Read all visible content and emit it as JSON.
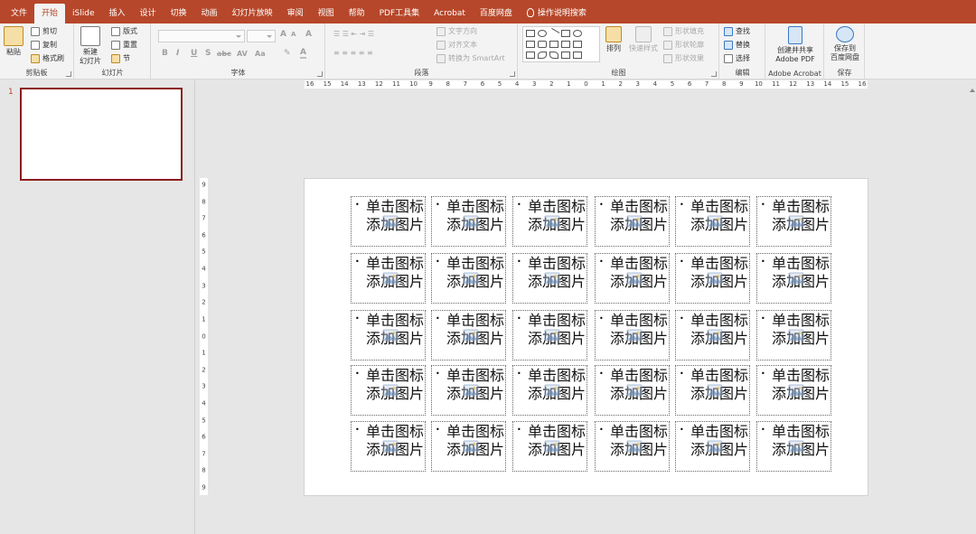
{
  "menu": {
    "tabs": [
      {
        "label": "文件"
      },
      {
        "label": "开始",
        "active": true
      },
      {
        "label": "iSlide"
      },
      {
        "label": "插入"
      },
      {
        "label": "设计"
      },
      {
        "label": "切换"
      },
      {
        "label": "动画"
      },
      {
        "label": "幻灯片放映"
      },
      {
        "label": "审阅"
      },
      {
        "label": "视图"
      },
      {
        "label": "帮助"
      },
      {
        "label": "PDF工具集"
      },
      {
        "label": "Acrobat"
      },
      {
        "label": "百度网盘"
      }
    ],
    "tell_me": "操作说明搜索",
    "accent_color": "#b7472a"
  },
  "ribbon": {
    "clipboard": {
      "paste": "粘贴",
      "cut": "剪切",
      "copy": "复制",
      "format_painter": "格式刷",
      "label": "剪贴板"
    },
    "slides": {
      "new_slide": "新建",
      "new_slide_line2": "幻灯片",
      "layout": "版式",
      "reset": "重置",
      "section": "节",
      "label": "幻灯片"
    },
    "font": {
      "label": "字体",
      "bold": "B",
      "italic": "I",
      "underline": "U",
      "strike": "S",
      "shadow": "abc",
      "spacing": "AV",
      "case": "Aa",
      "grow": "A",
      "shrink": "A",
      "clear": "A",
      "color": "A"
    },
    "paragraph": {
      "text_direction": "文字方向",
      "align_text": "对齐文本",
      "smartart": "转换为 SmartArt",
      "label": "段落"
    },
    "drawing": {
      "arrange": "排列",
      "quick_styles": "快速样式",
      "shape_fill": "形状填充",
      "shape_outline": "形状轮廓",
      "shape_effects": "形状效果",
      "label": "绘图"
    },
    "editing": {
      "find": "查找",
      "replace": "替换",
      "select": "选择",
      "label": "编辑"
    },
    "adobe": {
      "create_line1": "创建并共享",
      "create_line2": "Adobe PDF",
      "label": "Adobe Acrobat"
    },
    "save": {
      "line1": "保存到",
      "line2": "百度网盘",
      "label": "保存"
    }
  },
  "left_pane": {
    "slide_number": "1"
  },
  "rulers": {
    "horizontal": [
      "16",
      "15",
      "14",
      "13",
      "12",
      "11",
      "10",
      "9",
      "8",
      "7",
      "6",
      "5",
      "4",
      "3",
      "2",
      "1",
      "0",
      "1",
      "2",
      "3",
      "4",
      "5",
      "6",
      "7",
      "8",
      "9",
      "10",
      "11",
      "12",
      "13",
      "14",
      "15",
      "16"
    ],
    "vertical": [
      "9",
      "8",
      "7",
      "6",
      "5",
      "4",
      "3",
      "2",
      "1",
      "0",
      "1",
      "2",
      "3",
      "4",
      "5",
      "6",
      "7",
      "8",
      "9"
    ]
  },
  "slide": {
    "placeholder_rows": 5,
    "placeholder_cols": 6,
    "placeholder_text": "单击图标添加图片"
  }
}
